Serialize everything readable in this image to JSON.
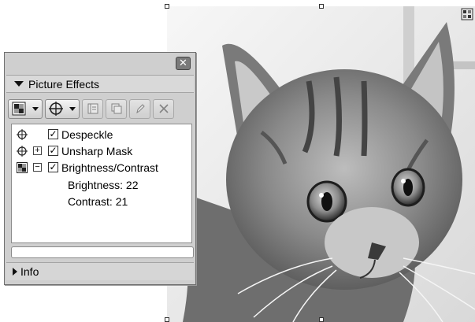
{
  "panel": {
    "title": "Picture Effects",
    "close_glyph": "✕",
    "info_label": "Info",
    "field_value": ""
  },
  "toolbar": {
    "buttons": [
      {
        "name": "effect-brightness-icon",
        "dropdown": true,
        "enabled": true
      },
      {
        "name": "effect-target-icon",
        "dropdown": true,
        "enabled": true
      },
      {
        "name": "move-up-icon",
        "dropdown": false,
        "enabled": false
      },
      {
        "name": "duplicate-icon",
        "dropdown": false,
        "enabled": false
      },
      {
        "name": "edit-pencil-icon",
        "dropdown": false,
        "enabled": false
      },
      {
        "name": "delete-x-icon",
        "dropdown": false,
        "enabled": false
      }
    ]
  },
  "effects": [
    {
      "label": "Despeckle",
      "checked": true,
      "expander": "",
      "icon": "target-icon"
    },
    {
      "label": "Unsharp Mask",
      "checked": true,
      "expander": "⊞",
      "icon": "target-icon"
    },
    {
      "label": "Brightness/Contrast",
      "checked": true,
      "expander": "⊟",
      "icon": "brightness-icon",
      "params": [
        "Brightness: 22",
        "Contrast: 21"
      ]
    }
  ],
  "canvas": {
    "image": "kitten-photo",
    "corner_icon": "grid-move-icon"
  }
}
